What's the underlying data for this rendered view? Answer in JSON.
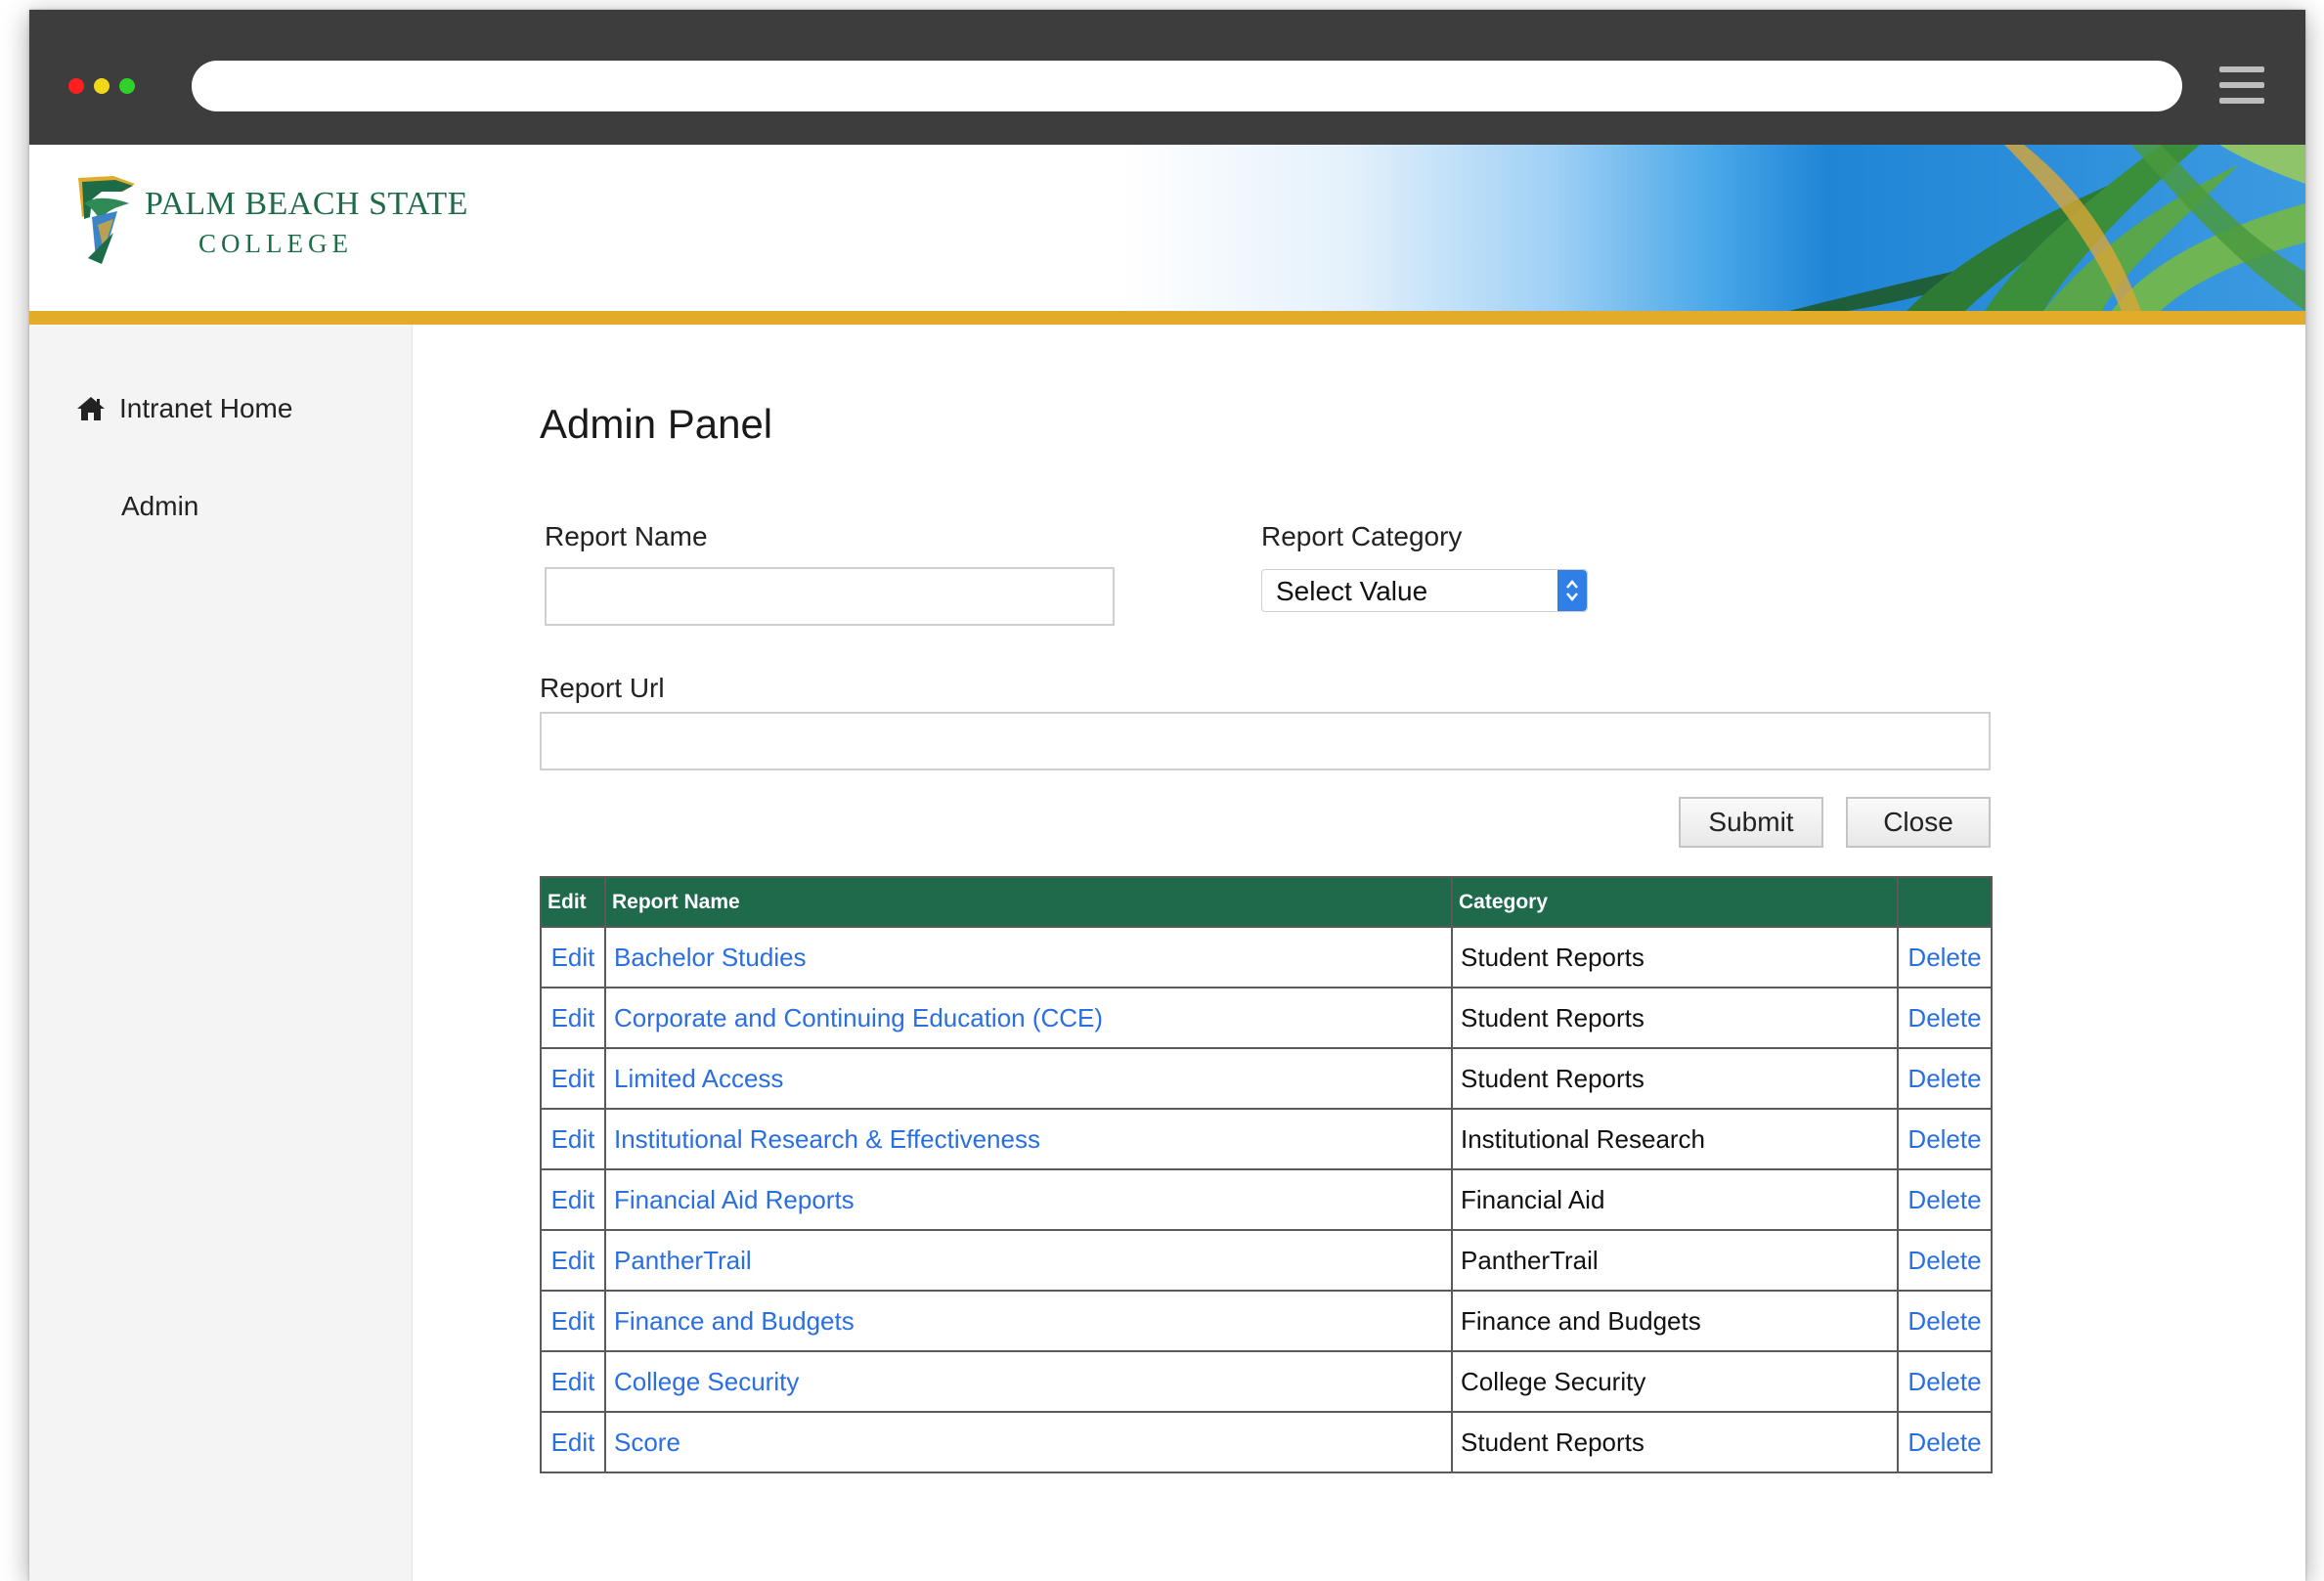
{
  "header": {
    "logo_line1": "PALM BEACH STATE",
    "logo_line2": "COLLEGE"
  },
  "sidebar": {
    "items": [
      {
        "label": "Intranet Home",
        "icon": "home-icon"
      },
      {
        "label": "Admin"
      }
    ]
  },
  "main": {
    "title": "Admin Panel",
    "form": {
      "report_name_label": "Report Name",
      "report_name_value": "",
      "report_category_label": "Report Category",
      "report_category_selected": "Select Value",
      "report_url_label": "Report Url",
      "report_url_value": ""
    },
    "buttons": {
      "submit": "Submit",
      "close": "Close"
    },
    "table": {
      "headers": {
        "edit": "Edit",
        "report_name": "Report Name",
        "category": "Category",
        "actions": ""
      },
      "rows": [
        {
          "edit": "Edit",
          "name": "Bachelor Studies",
          "category": "Student Reports",
          "delete": "Delete"
        },
        {
          "edit": "Edit",
          "name": "Corporate and Continuing Education (CCE)",
          "category": "Student Reports",
          "delete": "Delete"
        },
        {
          "edit": "Edit",
          "name": "Limited Access",
          "category": "Student Reports",
          "delete": "Delete"
        },
        {
          "edit": "Edit",
          "name": "Institutional Research & Effectiveness",
          "category": "Institutional Research",
          "delete": "Delete"
        },
        {
          "edit": "Edit",
          "name": "Financial Aid Reports",
          "category": "Financial Aid",
          "delete": "Delete"
        },
        {
          "edit": "Edit",
          "name": "PantherTrail",
          "category": "PantherTrail",
          "delete": "Delete"
        },
        {
          "edit": "Edit",
          "name": "Finance and Budgets",
          "category": "Finance and Budgets",
          "delete": "Delete"
        },
        {
          "edit": "Edit",
          "name": "College Security",
          "category": "College Security",
          "delete": "Delete"
        },
        {
          "edit": "Edit",
          "name": "Score",
          "category": "Student Reports",
          "delete": "Delete"
        }
      ]
    }
  },
  "colors": {
    "table_header": "#1f6a4b",
    "link": "#2a6fe0",
    "accent_gold": "#e3ab2a",
    "chrome": "#3d3d3d"
  }
}
